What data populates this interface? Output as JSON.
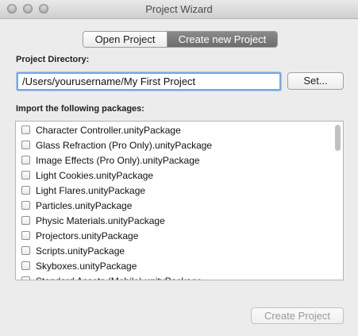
{
  "window": {
    "title": "Project Wizard"
  },
  "tabs": [
    {
      "label": "Open Project",
      "selected": false
    },
    {
      "label": "Create new Project",
      "selected": true
    }
  ],
  "project_directory": {
    "label": "Project Directory:",
    "value": "/Users/yourusername/My First Project",
    "browse_button": "Set..."
  },
  "packages": {
    "label": "Import the following packages:",
    "items": [
      {
        "label": "Character Controller.unityPackage",
        "checked": false
      },
      {
        "label": "Glass Refraction (Pro Only).unityPackage",
        "checked": false
      },
      {
        "label": "Image Effects (Pro Only).unityPackage",
        "checked": false
      },
      {
        "label": "Light Cookies.unityPackage",
        "checked": false
      },
      {
        "label": "Light Flares.unityPackage",
        "checked": false
      },
      {
        "label": "Particles.unityPackage",
        "checked": false
      },
      {
        "label": "Physic Materials.unityPackage",
        "checked": false
      },
      {
        "label": "Projectors.unityPackage",
        "checked": false
      },
      {
        "label": "Scripts.unityPackage",
        "checked": false
      },
      {
        "label": "Skyboxes.unityPackage",
        "checked": false
      },
      {
        "label": "Standard Assets (Mobile).unityPackage",
        "checked": false
      }
    ]
  },
  "footer": {
    "create_button": "Create Project",
    "create_enabled": false
  }
}
